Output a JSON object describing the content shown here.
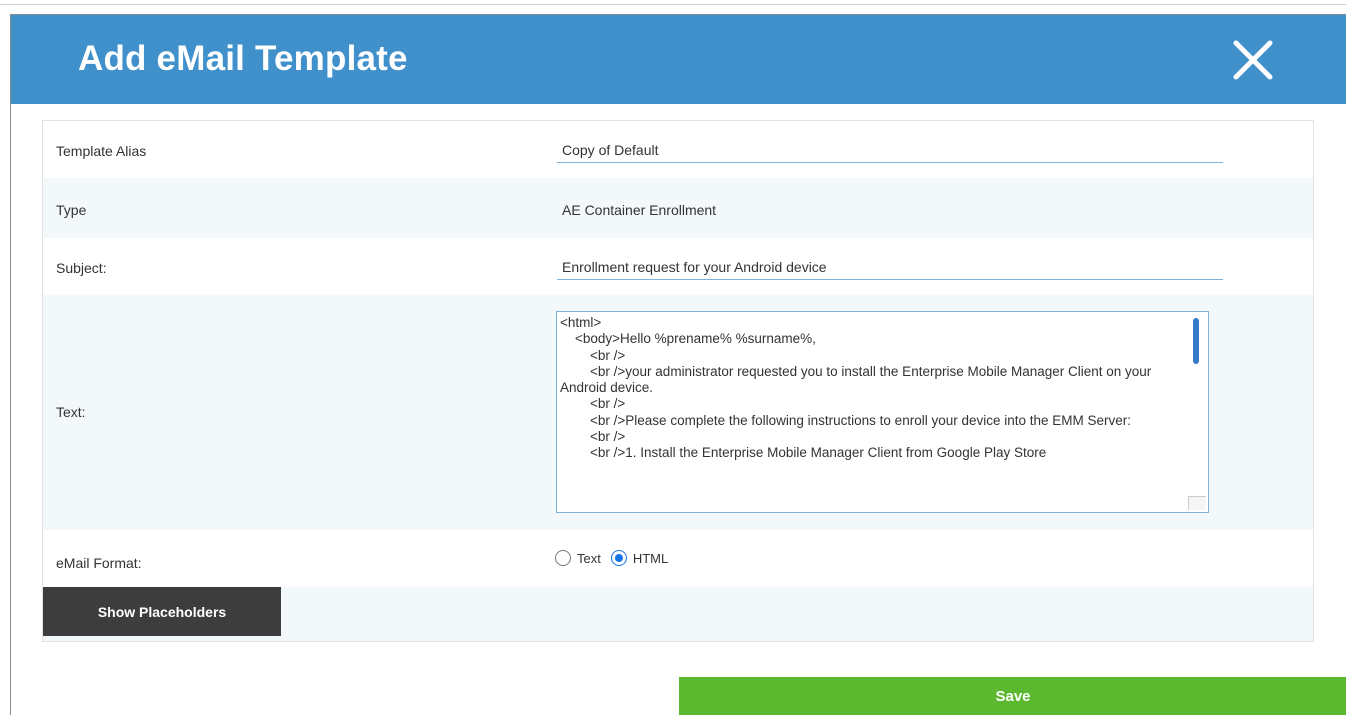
{
  "dialog": {
    "title": "Add eMail Template",
    "close_icon": "close-x-icon",
    "header_color": "#3f90cb"
  },
  "form": {
    "template_alias": {
      "label": "Template Alias",
      "value": "Copy of Default"
    },
    "type": {
      "label": "Type",
      "value": "AE Container Enrollment"
    },
    "subject": {
      "label": "Subject:",
      "value": "Enrollment request for your Android device"
    },
    "text": {
      "label": "Text:",
      "value": "<html>\n    <body>Hello %prename% %surname%,\n        <br />\n        <br />your administrator requested you to install the Enterprise Mobile Manager Client on your Android device.\n        <br />\n        <br />Please complete the following instructions to enroll your device into the EMM Server:\n        <br />\n        <br />1. Install the Enterprise Mobile Manager Client from Google Play Store"
    },
    "email_format": {
      "label": "eMail Format:",
      "options": [
        {
          "label": "Text",
          "checked": false
        },
        {
          "label": "HTML",
          "checked": true
        }
      ]
    }
  },
  "buttons": {
    "show_placeholders": "Show Placeholders",
    "save": "Save",
    "save_color": "#5cb82f"
  }
}
